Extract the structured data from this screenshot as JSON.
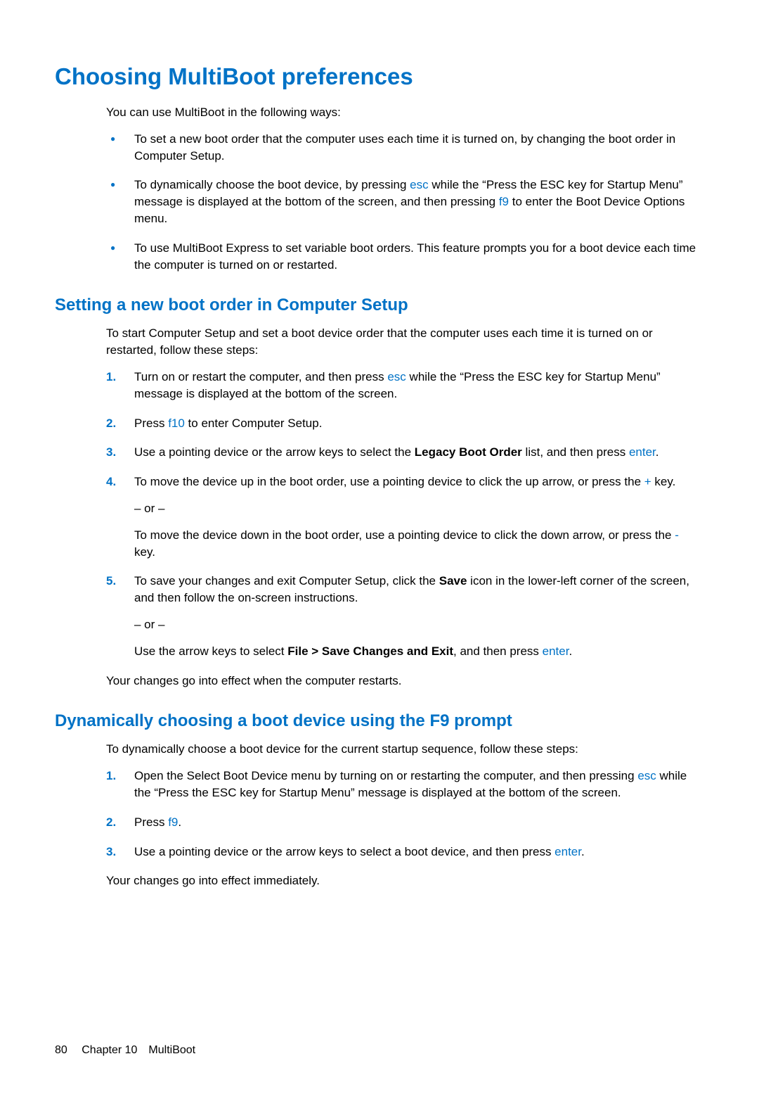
{
  "h1": "Choosing MultiBoot preferences",
  "intro": "You can use MultiBoot in the following ways:",
  "bullets": {
    "b1": "To set a new boot order that the computer uses each time it is turned on, by changing the boot order in Computer Setup.",
    "b2a": "To dynamically choose the boot device, by pressing ",
    "b2_esc": "esc",
    "b2b": " while the “Press the ESC key for Startup Menu” message is displayed at the bottom of the screen, and then pressing ",
    "b2_f9": "f9",
    "b2c": " to enter the Boot Device Options menu.",
    "b3": "To use MultiBoot Express to set variable boot orders. This feature prompts you for a boot device each time the computer is turned on or restarted."
  },
  "section1": {
    "title": "Setting a new boot order in Computer Setup",
    "intro": "To start Computer Setup and set a boot device order that the computer uses each time it is turned on or restarted, follow these steps:",
    "s1a": "Turn on or restart the computer, and then press ",
    "s1_esc": "esc",
    "s1b": " while the “Press the ESC key for Startup Menu” message is displayed at the bottom of the screen.",
    "s2a": "Press ",
    "s2_f10": "f10",
    "s2b": " to enter Computer Setup.",
    "s3a": "Use a pointing device or the arrow keys to select the ",
    "s3_bold": "Legacy Boot Order",
    "s3b": " list, and then press ",
    "s3_enter": "enter",
    "s3c": ".",
    "s4a": "To move the device up in the boot order, use a pointing device to click the up arrow, or press the ",
    "s4_plus": "+",
    "s4b": " key.",
    "s4_or": "– or –",
    "s4c": "To move the device down in the boot order, use a pointing device to click the down arrow, or press the ",
    "s4_minus": "-",
    "s4d": " key.",
    "s5a": "To save your changes and exit Computer Setup, click the ",
    "s5_bold": "Save",
    "s5b": " icon in the lower-left corner of the screen, and then follow the on-screen instructions.",
    "s5_or": "– or –",
    "s5c": "Use the arrow keys to select ",
    "s5_bold2": "File > Save Changes and Exit",
    "s5d": ", and then press ",
    "s5_enter": "enter",
    "s5e": ".",
    "outro": "Your changes go into effect when the computer restarts."
  },
  "section2": {
    "title": "Dynamically choosing a boot device using the F9 prompt",
    "intro": "To dynamically choose a boot device for the current startup sequence, follow these steps:",
    "s1a": "Open the Select Boot Device menu by turning on or restarting the computer, and then pressing ",
    "s1_esc": "esc",
    "s1b": " while the “Press the ESC key for Startup Menu” message is displayed at the bottom of the screen.",
    "s2a": "Press ",
    "s2_f9": "f9",
    "s2b": ".",
    "s3a": "Use a pointing device or the arrow keys to select a boot device, and then press ",
    "s3_enter": "enter",
    "s3b": ".",
    "outro": "Your changes go into effect immediately."
  },
  "footer": {
    "page": "80",
    "chapter": "Chapter 10 MultiBoot"
  }
}
